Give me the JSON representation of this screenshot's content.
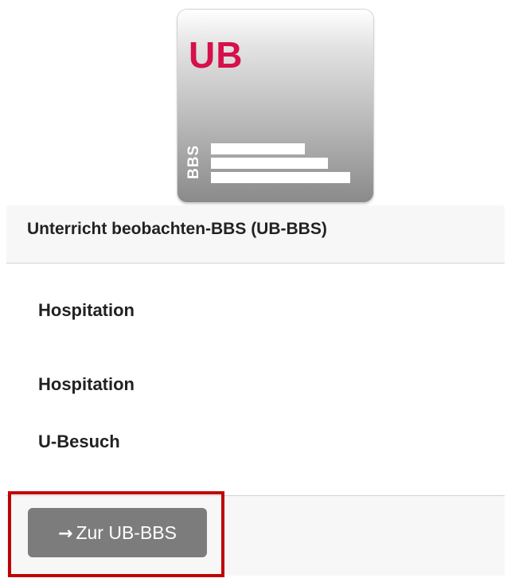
{
  "logo": {
    "main_text": "UB",
    "side_text": "BBS",
    "accent_color": "#d6104a"
  },
  "card": {
    "title": "Unterricht beobachten-BBS (UB-BBS)",
    "items": [
      {
        "label": "Hospitation"
      },
      {
        "label": "Hospitation"
      },
      {
        "label": "U-Besuch"
      }
    ],
    "footer": {
      "button_icon": "arrow-right-icon",
      "button_arrow": "→",
      "button_label": "Zur UB-BBS",
      "button_color": "#7c7c7c",
      "highlight_color": "#c00000"
    }
  }
}
